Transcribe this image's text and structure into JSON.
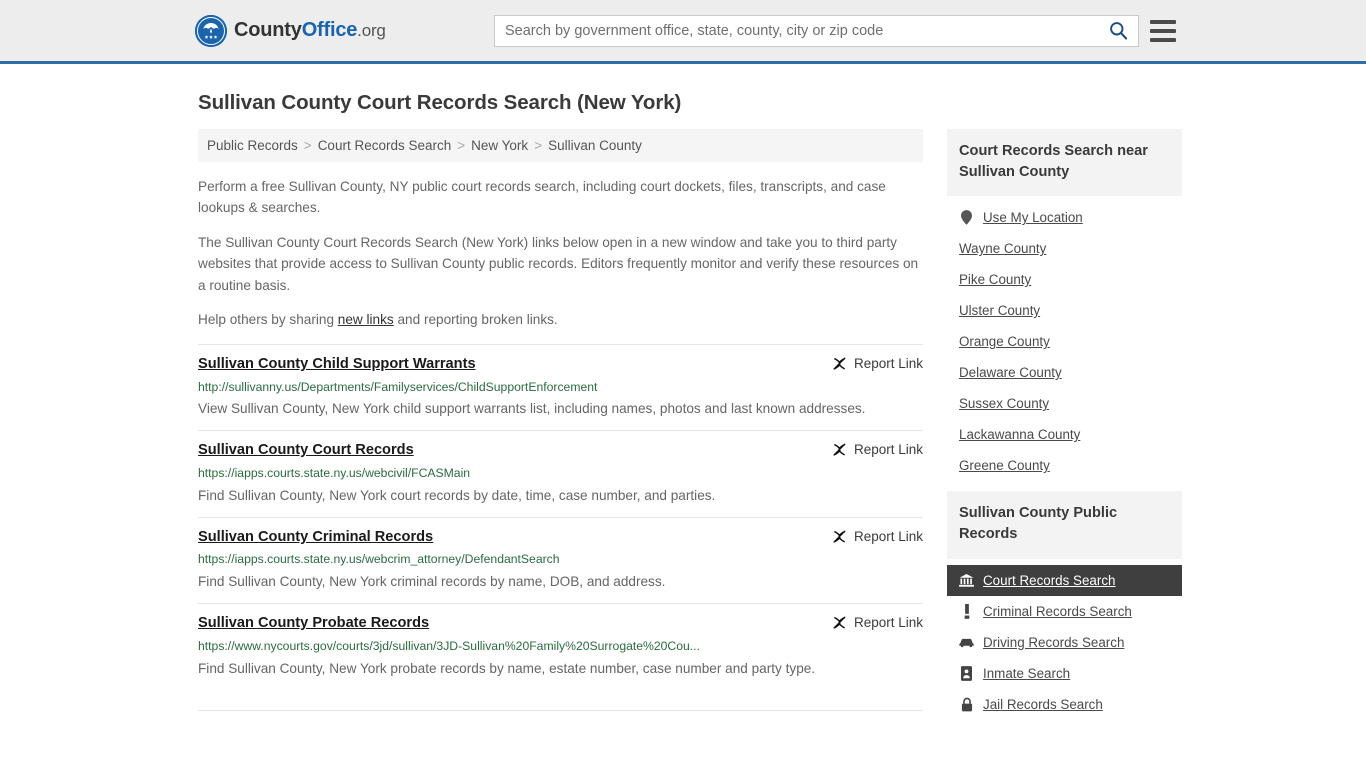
{
  "header": {
    "logo": {
      "part1": "County",
      "part2": "Office",
      "tld": ".org",
      "icon": "eagle-seal-logo"
    },
    "search": {
      "placeholder": "Search by government office, state, county, city or zip code",
      "value": "",
      "submit_icon": "search-icon"
    },
    "menu_icon": "hamburger-menu-icon",
    "accent_color": "#2f6da8",
    "background_color": "#ededed"
  },
  "page": {
    "title": "Sullivan County Court Records Search (New York)"
  },
  "breadcrumb": {
    "separator": ">",
    "items": [
      {
        "label": "Public Records"
      },
      {
        "label": "Court Records Search"
      },
      {
        "label": "New York"
      },
      {
        "label": "Sullivan County"
      }
    ]
  },
  "intro": {
    "paragraph1": "Perform a free Sullivan County, NY public court records search, including court dockets, files, transcripts, and case lookups & searches.",
    "paragraph2": "The Sullivan County Court Records Search (New York) links below open in a new window and take you to third party websites that provide access to Sullivan County public records. Editors frequently monitor and verify these resources on a routine basis.",
    "help_prefix": "Help others by sharing ",
    "help_link": "new links",
    "help_suffix": " and reporting broken links."
  },
  "results": {
    "report_label": "Report Link",
    "report_icon": "broken-link-icon",
    "items": [
      {
        "title": "Sullivan County Child Support Warrants",
        "url": "http://sullivanny.us/Departments/Familyservices/ChildSupportEnforcement",
        "description": "View Sullivan County, New York child support warrants list, including names, photos and last known addresses."
      },
      {
        "title": "Sullivan County Court Records",
        "url": "https://iapps.courts.state.ny.us/webcivil/FCASMain",
        "description": "Find Sullivan County, New York court records by date, time, case number, and parties."
      },
      {
        "title": "Sullivan County Criminal Records",
        "url": "https://iapps.courts.state.ny.us/webcrim_attorney/DefendantSearch",
        "description": "Find Sullivan County, New York criminal records by name, DOB, and address."
      },
      {
        "title": "Sullivan County Probate Records",
        "url": "https://www.nycourts.gov/courts/3jd/sullivan/3JD-Sullivan%20Family%20Surrogate%20Cou...",
        "description": "Find Sullivan County, New York probate records by name, estate number, case number and party type."
      }
    ]
  },
  "sidebar": {
    "nearby": {
      "heading": "Court Records Search near Sullivan County",
      "items": [
        {
          "label": "Use My Location",
          "icon": "map-pin-icon"
        },
        {
          "label": "Wayne County",
          "icon": ""
        },
        {
          "label": "Pike County",
          "icon": ""
        },
        {
          "label": "Ulster County",
          "icon": ""
        },
        {
          "label": "Orange County",
          "icon": ""
        },
        {
          "label": "Delaware County",
          "icon": ""
        },
        {
          "label": "Sussex County",
          "icon": ""
        },
        {
          "label": "Lackawanna County",
          "icon": ""
        },
        {
          "label": "Greene County",
          "icon": ""
        }
      ]
    },
    "public_records": {
      "heading": "Sullivan County Public Records",
      "items": [
        {
          "label": "Court Records Search",
          "icon": "courthouse-icon",
          "active": true
        },
        {
          "label": "Criminal Records Search",
          "icon": "exclamation-icon",
          "active": false
        },
        {
          "label": "Driving Records Search",
          "icon": "car-icon",
          "active": false
        },
        {
          "label": "Inmate Search",
          "icon": "id-badge-icon",
          "active": false
        },
        {
          "label": "Jail Records Search",
          "icon": "lock-icon",
          "active": false
        }
      ]
    }
  }
}
